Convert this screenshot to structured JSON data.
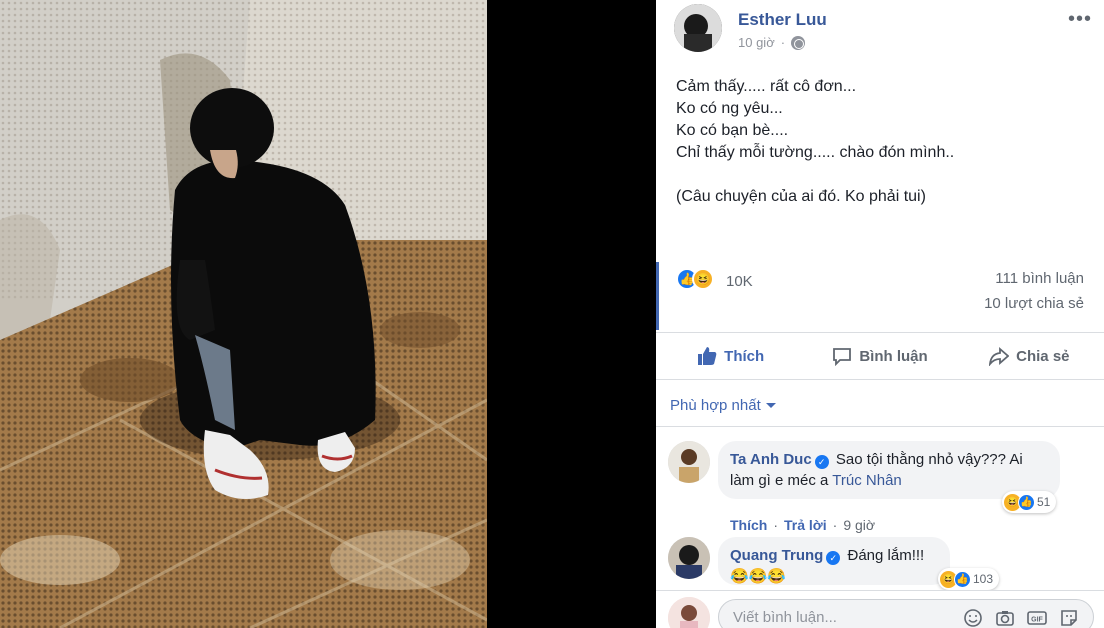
{
  "post": {
    "author": "Esther Luu",
    "time": "10 giờ",
    "separator": "·",
    "more_label": "•••",
    "lines": [
      "Cảm thấy..... rất cô đơn...",
      "Ko có ng yêu...",
      "Ko có bạn bè....",
      "Chỉ thấy mỗi tường..... chào đón mình..",
      "",
      "(Câu chuyện của ai đó. Ko phải tui)"
    ]
  },
  "stats": {
    "reactions": "10K",
    "comments": "111 bình luận",
    "shares": "10 lượt chia sẻ"
  },
  "actions": {
    "like": "Thích",
    "comment": "Bình luận",
    "share": "Chia sẻ"
  },
  "sort": {
    "label": "Phù hợp nhất"
  },
  "comments": [
    {
      "name": "Ta Anh Duc",
      "text_line1": "Sao tội thằng nhỏ vậy??? Ai",
      "text_line2_prefix": "làm gì e méc a ",
      "tag": "Trúc Nhân",
      "reaction_count": "51",
      "like": "Thích",
      "reply": "Trả lời",
      "time": "9 giờ",
      "dot": "·"
    },
    {
      "name": "Quang Trung",
      "text": "Đáng lắm!!!",
      "emojis": "😂😂😂",
      "reaction_count": "103"
    }
  ],
  "composer": {
    "placeholder": "Viết bình luận..."
  },
  "colors": {
    "link": "#385898",
    "accent": "#4267b2",
    "muted": "#606770",
    "bubble": "#f2f3f5"
  },
  "icons": [
    "globe-icon",
    "like-icon",
    "haha-icon",
    "comment-icon",
    "share-icon",
    "verified-icon",
    "emoji-icon",
    "camera-icon",
    "gif-icon",
    "sticker-icon"
  ]
}
